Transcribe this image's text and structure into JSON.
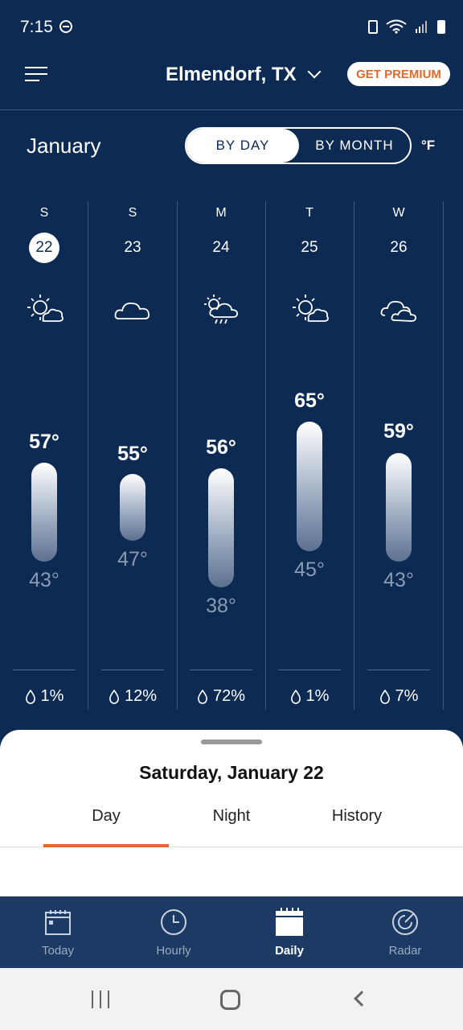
{
  "status_bar": {
    "time": "7:15"
  },
  "header": {
    "location": "Elmendorf, TX",
    "premium_label": "GET PREMIUM"
  },
  "controls": {
    "month": "January",
    "by_day": "BY DAY",
    "by_month": "BY MONTH",
    "unit": "°F"
  },
  "days": [
    {
      "dow": "S",
      "date": "22",
      "selected": true,
      "icon": "partly-cloudy-sun-icon",
      "high": "57°",
      "low": "43°",
      "precip": "1%"
    },
    {
      "dow": "S",
      "date": "23",
      "selected": false,
      "icon": "cloud-icon",
      "high": "55°",
      "low": "47°",
      "precip": "12%"
    },
    {
      "dow": "M",
      "date": "24",
      "selected": false,
      "icon": "sun-cloud-rain-icon",
      "high": "56°",
      "low": "38°",
      "precip": "72%"
    },
    {
      "dow": "T",
      "date": "25",
      "selected": false,
      "icon": "partly-cloudy-sun-icon",
      "high": "65°",
      "low": "45°",
      "precip": "1%"
    },
    {
      "dow": "W",
      "date": "26",
      "selected": false,
      "icon": "clouds-icon",
      "high": "59°",
      "low": "43°",
      "precip": "7%"
    }
  ],
  "sheet": {
    "title": "Saturday, January 22",
    "tabs": [
      "Day",
      "Night",
      "History"
    ],
    "active_tab": "Day"
  },
  "nav": [
    {
      "label": "Today",
      "icon": "calendar-day-icon"
    },
    {
      "label": "Hourly",
      "icon": "clock-icon"
    },
    {
      "label": "Daily",
      "icon": "calendar-icon",
      "active": true
    },
    {
      "label": "Radar",
      "icon": "radar-icon"
    }
  ],
  "colors": {
    "background": "#0d2a52",
    "accent": "#e06a2a",
    "nav_bg": "#1c3a63"
  }
}
